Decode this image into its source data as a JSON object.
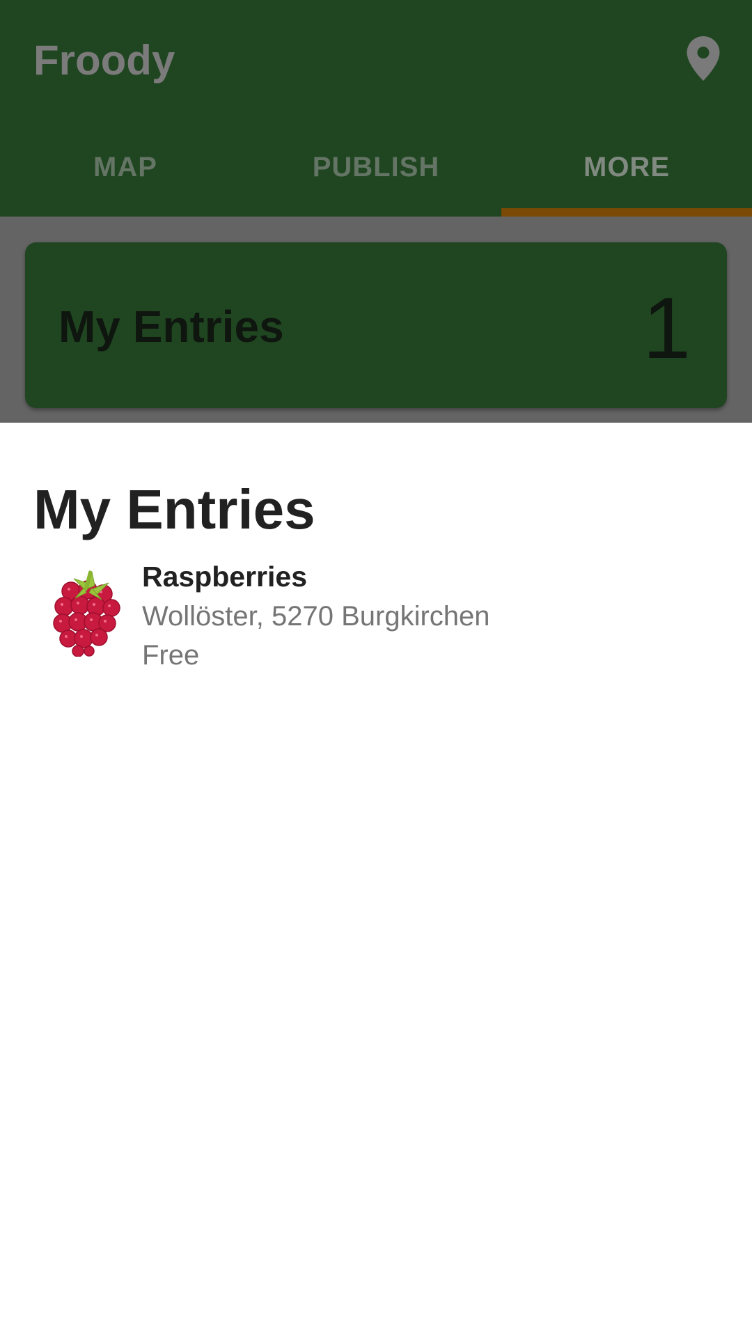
{
  "app": {
    "title": "Froody",
    "location_icon": "map-marker-icon"
  },
  "tabs": [
    {
      "label": "MAP",
      "active": false
    },
    {
      "label": "PUBLISH",
      "active": false
    },
    {
      "label": "MORE",
      "active": true
    }
  ],
  "my_entries_card": {
    "label": "My Entries",
    "count": "1"
  },
  "sheet": {
    "title": "My Entries",
    "entries": [
      {
        "icon": "raspberry-icon",
        "name": "Raspberries",
        "address": "Wollöster, 5270 Burgkirchen",
        "price": "Free"
      }
    ]
  },
  "colors": {
    "appbar": "#204621",
    "tab_indicator": "#7b4a06",
    "scrim": "#646464",
    "sheet_background": "#ffffff",
    "primary_text": "#212121",
    "secondary_text": "#757575"
  }
}
